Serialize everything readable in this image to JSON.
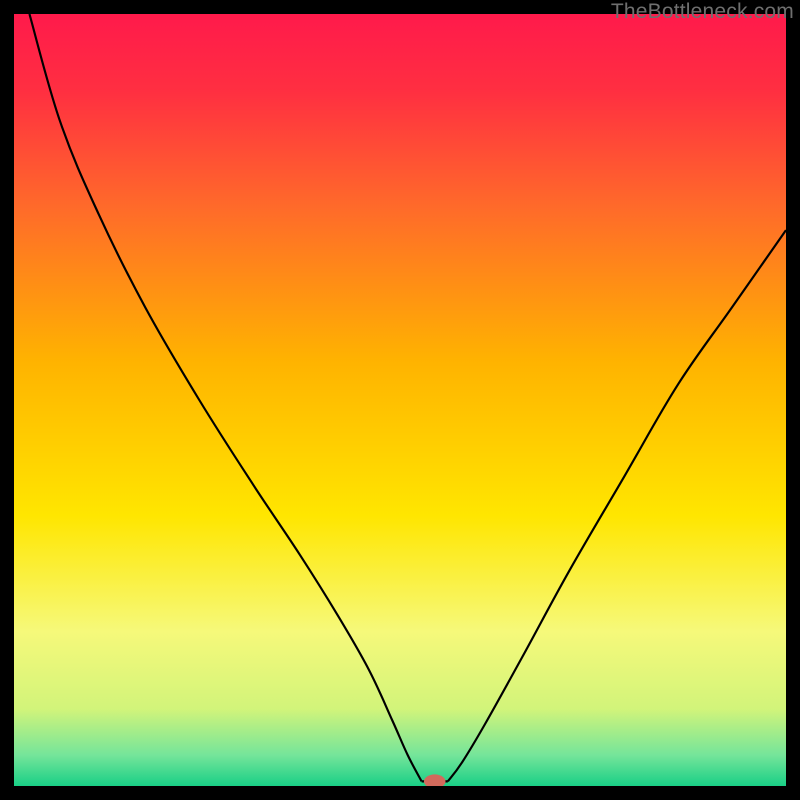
{
  "watermark": "TheBottleneck.com",
  "chart_data": {
    "type": "line",
    "title": "",
    "xlabel": "",
    "ylabel": "",
    "xlim": [
      0,
      100
    ],
    "ylim": [
      0,
      100
    ],
    "grid": false,
    "legend": false,
    "gradient_stops": [
      {
        "offset": 0.0,
        "color": "#ff1a4b"
      },
      {
        "offset": 0.1,
        "color": "#ff2f41"
      },
      {
        "offset": 0.25,
        "color": "#ff6a2a"
      },
      {
        "offset": 0.45,
        "color": "#ffb300"
      },
      {
        "offset": 0.65,
        "color": "#ffe600"
      },
      {
        "offset": 0.8,
        "color": "#f6f97a"
      },
      {
        "offset": 0.9,
        "color": "#d2f47a"
      },
      {
        "offset": 0.96,
        "color": "#75e59a"
      },
      {
        "offset": 1.0,
        "color": "#19cf86"
      }
    ],
    "series": [
      {
        "name": "left-branch",
        "x": [
          2,
          6,
          11,
          17,
          24,
          31,
          37,
          42,
          46,
          49,
          51,
          52.8
        ],
        "values": [
          100,
          86,
          74,
          62,
          50,
          39,
          30,
          22,
          15,
          8.5,
          4,
          0.6
        ]
      },
      {
        "name": "right-branch",
        "x": [
          56.2,
          58,
          61,
          66,
          72,
          79,
          86,
          93,
          100
        ],
        "values": [
          0.6,
          3,
          8,
          17,
          28,
          40,
          52,
          62,
          72
        ]
      }
    ],
    "flat_segment": {
      "x": [
        52.8,
        56.2
      ],
      "y": 0.6
    },
    "marker": {
      "x": 54.5,
      "y": 0.6,
      "color": "#d26a5c",
      "rx": 1.4,
      "ry": 0.9
    }
  }
}
